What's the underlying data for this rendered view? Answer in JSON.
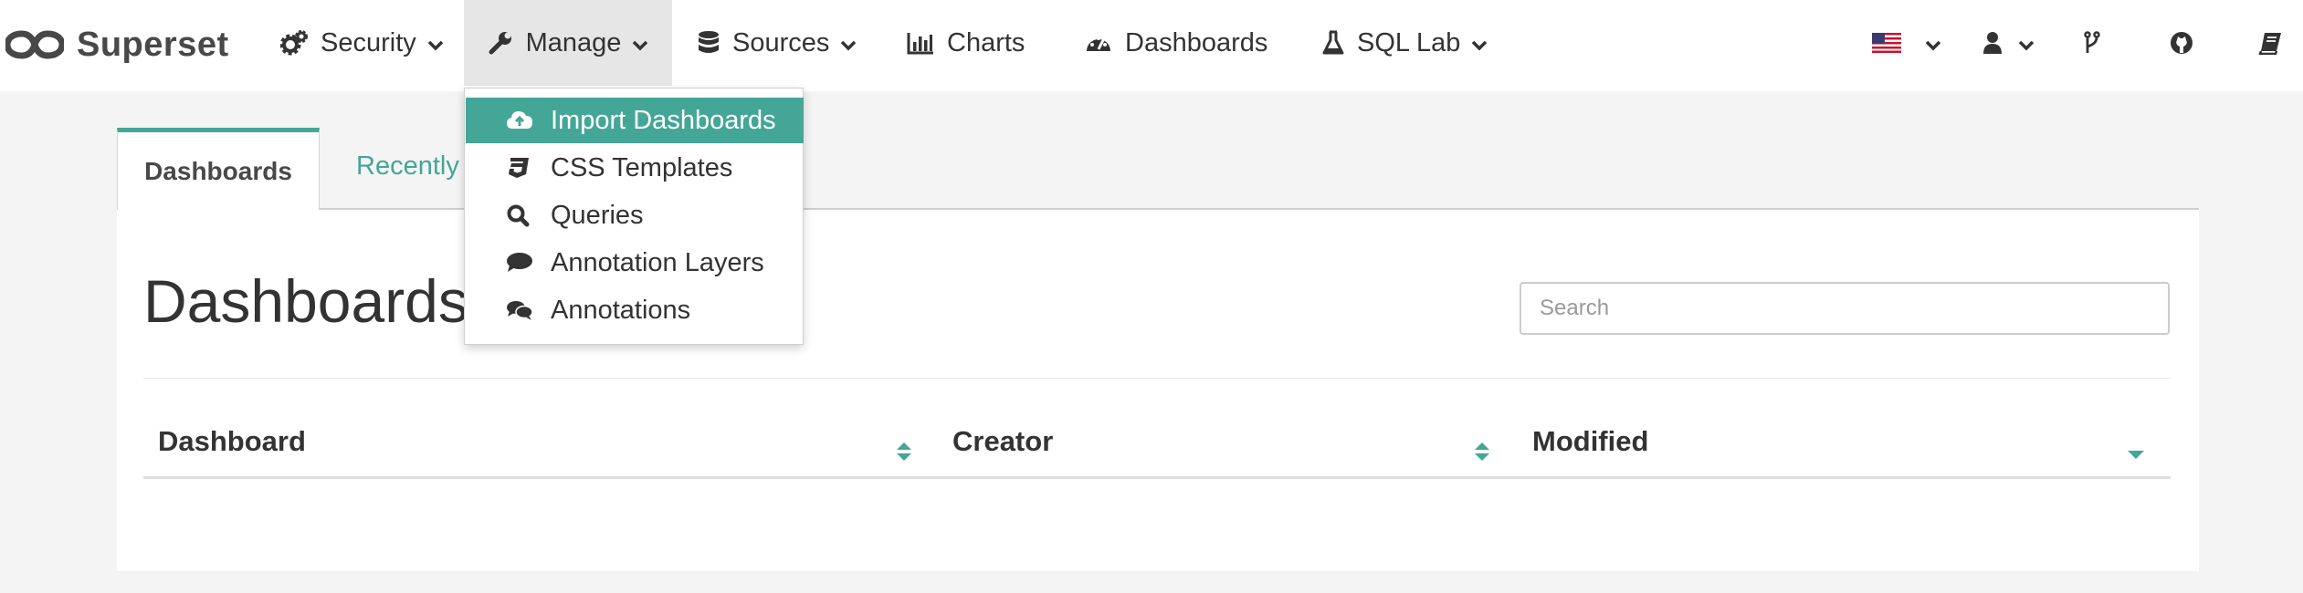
{
  "brand": {
    "name": "Superset"
  },
  "nav": {
    "security": "Security",
    "manage": "Manage",
    "sources": "Sources",
    "charts": "Charts",
    "dashboards": "Dashboards",
    "sqllab": "SQL Lab"
  },
  "manage_menu": {
    "items": [
      {
        "label": "Import Dashboards",
        "icon": "cloud-upload-icon",
        "highlighted": true
      },
      {
        "label": "CSS Templates",
        "icon": "css3-icon"
      },
      {
        "label": "Queries",
        "icon": "search-icon"
      },
      {
        "label": "Annotation Layers",
        "icon": "comment-icon"
      },
      {
        "label": "Annotations",
        "icon": "comments-icon"
      }
    ]
  },
  "right_icons": [
    "flag-us-icon",
    "user-icon",
    "git-branch-icon",
    "github-icon",
    "book-icon"
  ],
  "tabs": {
    "active": "Dashboards",
    "inactive": "Recently V"
  },
  "main": {
    "title": "Dashboards",
    "search_placeholder": "Search"
  },
  "table": {
    "columns": [
      "Dashboard",
      "Creator",
      "Modified"
    ]
  },
  "colors": {
    "accent": "#44a696",
    "brand_text": "#484848",
    "nav_active_bg": "#e6e6e6"
  }
}
